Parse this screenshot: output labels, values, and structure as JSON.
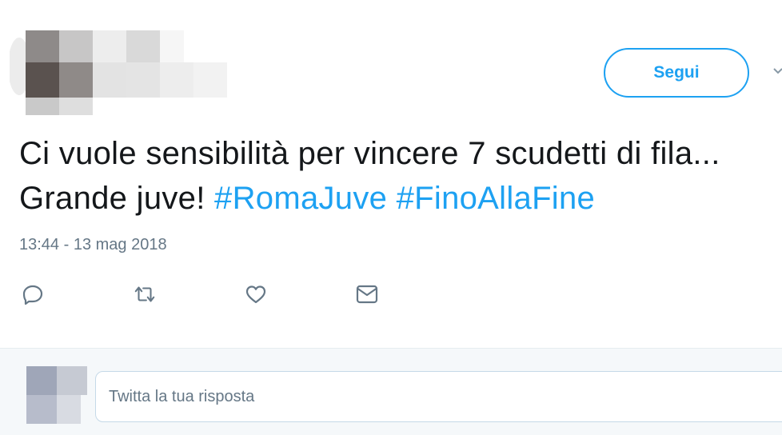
{
  "follow": {
    "label": "Segui"
  },
  "tweet": {
    "text_part1": "Ci vuole sensibilità per vincere 7 scudetti di fila... Grande juve! ",
    "hashtags": [
      "#RomaJuve",
      "#FinoAllaFine"
    ],
    "timestamp": "13:44 - 13 mag 2018"
  },
  "actions": {
    "icons": [
      "reply-icon",
      "retweet-icon",
      "like-icon",
      "direct-message-icon"
    ]
  },
  "reply": {
    "placeholder": "Twitta la tua risposta"
  },
  "colors": {
    "accent": "#1da1f2",
    "text": "#14171a",
    "muted": "#657786",
    "reply_bg": "#f5f8fa"
  }
}
